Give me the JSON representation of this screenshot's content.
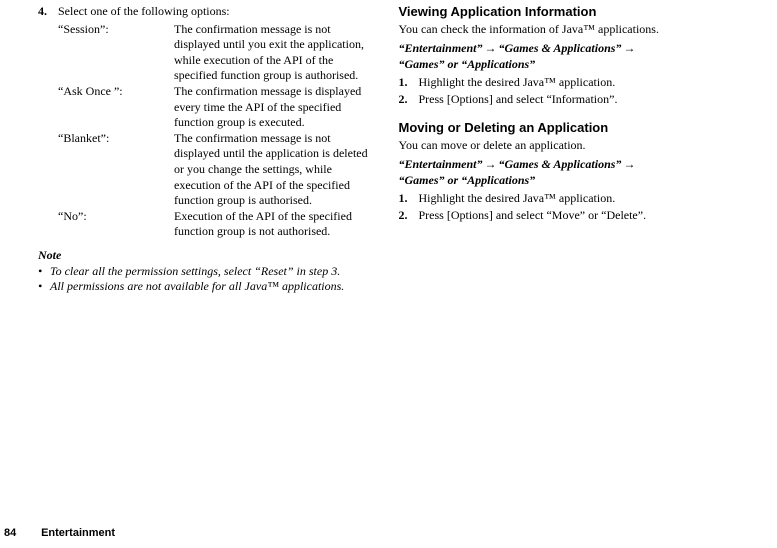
{
  "left": {
    "step": {
      "num": "4.",
      "text": "Select one of the following options:"
    },
    "options": [
      {
        "label": "“Session”:",
        "desc": "The confirmation message is not displayed until you exit the application, while execution of the API of the specified function group is authorised."
      },
      {
        "label": "“Ask Once ”:",
        "desc": "The confirmation message is displayed every time the API of the specified function group is executed."
      },
      {
        "label": "“Blanket”:",
        "desc": "The confirmation message is not displayed until the application is deleted or you change the settings, while execution of the API of the specified function group is authorised."
      },
      {
        "label": "“No”:",
        "desc": "Execution of the API of the specified function group is not authorised."
      }
    ],
    "note_heading": "Note",
    "notes": [
      "To clear all the permission settings, select “Reset” in step 3.",
      "All permissions are not available for all Java™ applications."
    ]
  },
  "right": {
    "sections": [
      {
        "heading": "Viewing Application Information",
        "body": "You can check the information of Java™ applications.",
        "path": {
          "a": "“Entertainment”",
          "b": "“Games & Applications”",
          "c": "“Games” or “Applications”"
        },
        "steps": [
          {
            "num": "1.",
            "text": "Highlight the desired Java™ application."
          },
          {
            "num": "2.",
            "text": "Press [Options] and select “Information”."
          }
        ]
      },
      {
        "heading": "Moving or Deleting an Application",
        "body": "You can move or delete an application.",
        "path": {
          "a": "“Entertainment”",
          "b": "“Games & Applications”",
          "c": "“Games” or “Applications”"
        },
        "steps": [
          {
            "num": "1.",
            "text": "Highlight the desired Java™ application."
          },
          {
            "num": "2.",
            "text": "Press [Options] and select “Move” or “Delete”."
          }
        ]
      }
    ]
  },
  "footer": {
    "page": "84",
    "title": "Entertainment"
  },
  "arrow": "→"
}
